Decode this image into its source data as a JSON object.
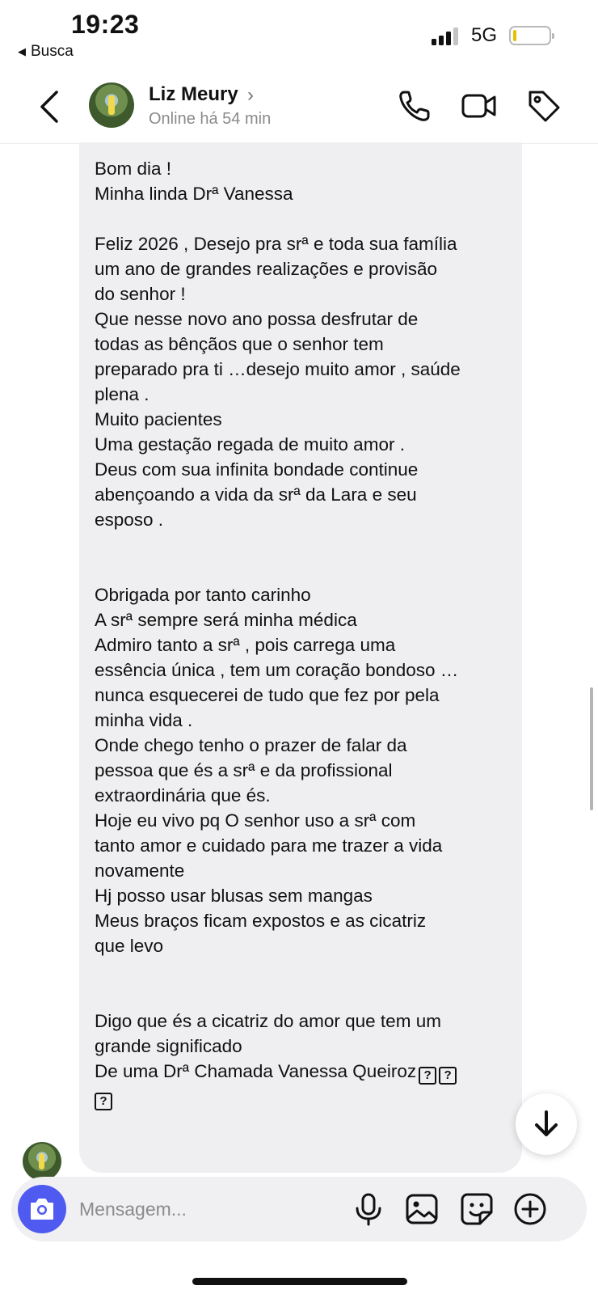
{
  "status_bar": {
    "time": "19:23",
    "back_label": "Busca",
    "network": "5G"
  },
  "header": {
    "contact_name": "Liz Meury",
    "contact_status": "Online há 54 min"
  },
  "message": {
    "lines": [
      "Bom dia !",
      "Minha linda Drª Vanessa",
      "",
      "Feliz 2026 , Desejo pra srª e toda sua família",
      "um ano de grandes realizações e provisão",
      "do senhor !",
      "Que nesse novo ano possa desfrutar de",
      "todas as bênçãos que o senhor tem",
      "preparado pra ti …desejo muito amor , saúde",
      "plena .",
      "Muito pacientes",
      "Uma gestação regada de muito amor .",
      "Deus com sua infinita bondade continue",
      "abençoando a vida da srª da Lara e seu",
      "esposo .",
      "",
      "",
      "Obrigada por tanto carinho",
      "A srª sempre será minha médica",
      "Admiro tanto a srª , pois carrega uma",
      "essência única , tem um coração bondoso …",
      "nunca esquecerei de tudo que fez por pela",
      "minha vida .",
      "Onde chego tenho o prazer de falar da",
      "pessoa que és a srª e da profissional",
      "extraordinária que és.",
      "Hoje eu vivo pq O senhor uso a srª com",
      "tanto amor e cuidado para me trazer a vida",
      "novamente",
      "Hj posso usar blusas sem mangas",
      "Meus braços ficam expostos e as cicatriz",
      "que levo",
      "",
      "",
      "Digo que és a cicatriz do amor que tem um",
      "grande significado",
      "De uma Drª Chamada Vanessa Queiroz"
    ],
    "missing_glyph": "?"
  },
  "composer": {
    "placeholder": "Mensagem..."
  },
  "icons": {
    "back": "chevron-left-icon",
    "call": "phone-icon",
    "video": "video-camera-icon",
    "tag": "tag-icon",
    "camera": "camera-icon",
    "mic": "microphone-icon",
    "gallery": "image-icon",
    "sticker": "sticker-icon",
    "plus": "plus-circle-icon",
    "scroll": "arrow-down-icon"
  },
  "colors": {
    "accent": "#4f5af0",
    "bubble": "#efeff1",
    "composer_bg": "#f0f0f2",
    "secondary_text": "#8a8a8a"
  }
}
